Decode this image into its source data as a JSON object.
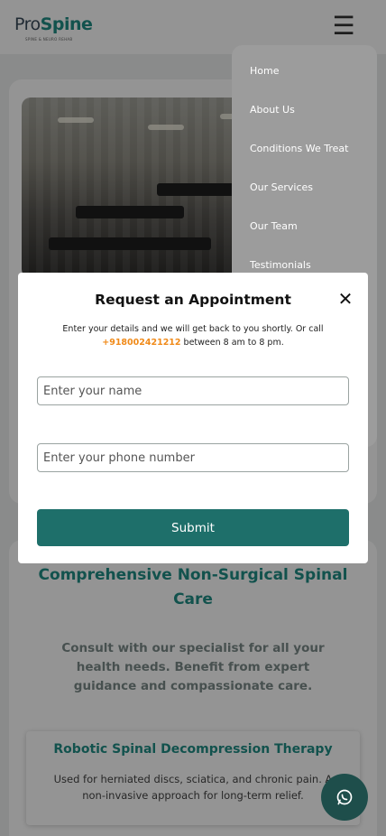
{
  "header": {
    "logo_brand_prefix": "Pro",
    "logo_brand_suffix": "Spine",
    "logo_tagline": "SPINE & NEURO REHAB",
    "menu_icon": "☰"
  },
  "nav": {
    "items": [
      {
        "label": "Home"
      },
      {
        "label": "About Us"
      },
      {
        "label": "Conditions We Treat"
      },
      {
        "label": "Our Services"
      },
      {
        "label": "Our Team"
      },
      {
        "label": "Testimonials"
      }
    ]
  },
  "section": {
    "title": "Comprehensive Non-Surgical Spinal Care",
    "subtitle": "Consult with our specialist for all your health needs. Benefit from expert guidance and compassionate care.",
    "card": {
      "title": "Robotic Spinal Decompression Therapy",
      "description": "Used for herniated discs, sciatica, and chronic pain. A non-invasive approach for long-term relief."
    }
  },
  "modal": {
    "title": "Request an Appointment",
    "close_icon": "✕",
    "desc_before": "Enter your details and we will get back to you shortly. Or call ",
    "phone": "+918002421212",
    "desc_after": " between 8 am to 8 pm.",
    "name_placeholder": "Enter your name",
    "phone_placeholder": "Enter your phone number",
    "submit_label": "Submit"
  },
  "colors": {
    "brand": "#1f8d86",
    "accent": "#f08a19",
    "button": "#1e6f6a"
  },
  "icons": {
    "chat": "whatsapp-icon"
  }
}
